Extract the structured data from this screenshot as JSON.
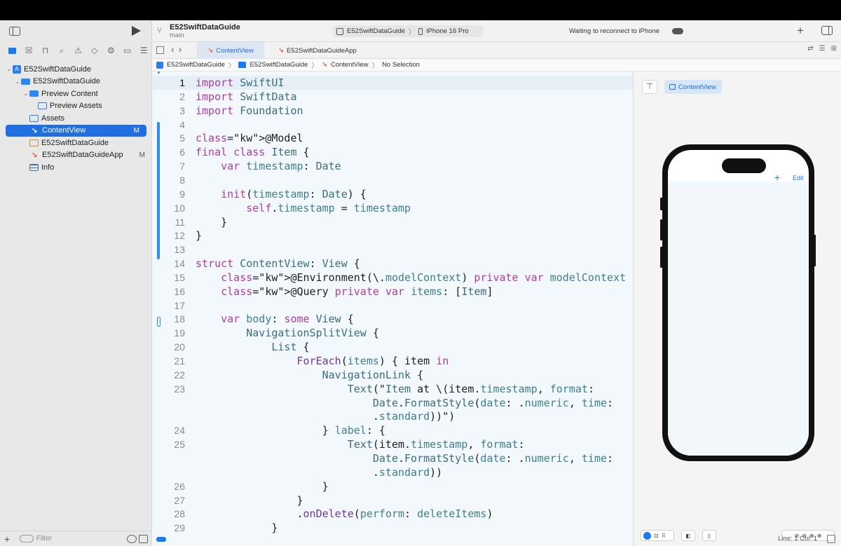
{
  "toolbar": {
    "project_name": "E52SwiftDataGuide",
    "branch": "main",
    "scheme_target": "E52SwiftDataGuide",
    "device": "iPhone 16 Pro",
    "status": "Waiting to reconnect to iPhone"
  },
  "tabs": [
    {
      "label": "ContentView",
      "active": true
    },
    {
      "label": "E52SwiftDataGuideApp",
      "active": false
    }
  ],
  "jumpbar": {
    "items": [
      "E52SwiftDataGuide",
      "E52SwiftDataGuide",
      "ContentView",
      "No Selection"
    ]
  },
  "navigator": {
    "filter_placeholder": "Filter",
    "tree": [
      {
        "label": "E52SwiftDataGuide",
        "indent": 0,
        "icon": "app-icon",
        "expanded": true,
        "badge": ""
      },
      {
        "label": "E52SwiftDataGuide",
        "indent": 1,
        "icon": "folder-icon",
        "expanded": true,
        "badge": ""
      },
      {
        "label": "Preview Content",
        "indent": 2,
        "icon": "folder-icon",
        "expanded": true,
        "badge": ""
      },
      {
        "label": "Preview Assets",
        "indent": 3,
        "icon": "asset-catalog-icon",
        "badge": ""
      },
      {
        "label": "Assets",
        "indent": 2,
        "icon": "asset-catalog-icon",
        "badge": ""
      },
      {
        "label": "ContentView",
        "indent": 2,
        "icon": "swift-file-icon",
        "badge": "M",
        "selected": true
      },
      {
        "label": "E52SwiftDataGuide",
        "indent": 2,
        "icon": "entitlements-icon",
        "badge": ""
      },
      {
        "label": "E52SwiftDataGuideApp",
        "indent": 2,
        "icon": "swift-file-icon",
        "badge": "M"
      },
      {
        "label": "Info",
        "indent": 2,
        "icon": "plist-icon",
        "badge": ""
      }
    ]
  },
  "editor": {
    "current_line": 1,
    "lines": [
      {
        "n": "1",
        "code": "import SwiftUI"
      },
      {
        "n": "2",
        "code": "import SwiftData"
      },
      {
        "n": "3",
        "code": "import Foundation"
      },
      {
        "n": "4",
        "code": ""
      },
      {
        "n": "5",
        "code": "@Model"
      },
      {
        "n": "6",
        "code": "final class Item {"
      },
      {
        "n": "7",
        "code": "    var timestamp: Date"
      },
      {
        "n": "8",
        "code": ""
      },
      {
        "n": "9",
        "code": "    init(timestamp: Date) {"
      },
      {
        "n": "10",
        "code": "        self.timestamp = timestamp"
      },
      {
        "n": "11",
        "code": "    }"
      },
      {
        "n": "12",
        "code": "}"
      },
      {
        "n": "13",
        "code": ""
      },
      {
        "n": "14",
        "code": "struct ContentView: View {"
      },
      {
        "n": "15",
        "code": "    @Environment(\\.modelContext) private var modelContext"
      },
      {
        "n": "16",
        "code": "    @Query private var items: [Item]"
      },
      {
        "n": "17",
        "code": ""
      },
      {
        "n": "18",
        "code": "    var body: some View {"
      },
      {
        "n": "19",
        "code": "        NavigationSplitView {"
      },
      {
        "n": "20",
        "code": "            List {"
      },
      {
        "n": "21",
        "code": "                ForEach(items) { item in"
      },
      {
        "n": "22",
        "code": "                    NavigationLink {"
      },
      {
        "n": "23",
        "code": "                        Text(\"Item at \\(item.timestamp, format:"
      },
      {
        "n": "",
        "code": "                            Date.FormatStyle(date: .numeric, time:"
      },
      {
        "n": "",
        "code": "                            .standard))\")"
      },
      {
        "n": "24",
        "code": "                    } label: {"
      },
      {
        "n": "25",
        "code": "                        Text(item.timestamp, format:"
      },
      {
        "n": "",
        "code": "                            Date.FormatStyle(date: .numeric, time:"
      },
      {
        "n": "",
        "code": "                            .standard))"
      },
      {
        "n": "26",
        "code": "                    }"
      },
      {
        "n": "27",
        "code": "                }"
      },
      {
        "n": "28",
        "code": "                .onDelete(perform: deleteItems)"
      },
      {
        "n": "29",
        "code": "            }"
      }
    ]
  },
  "canvas": {
    "preview_chip": "ContentView",
    "phone_edit": "Edit",
    "phone_plus": "+"
  },
  "statusbar": {
    "line_col": "Line: 1  Col: 1"
  },
  "colors": {
    "accent": "#1a6fe3",
    "keyword": "#ad3da4",
    "type": "#3a6d80",
    "swift_orange": "#f05138"
  }
}
